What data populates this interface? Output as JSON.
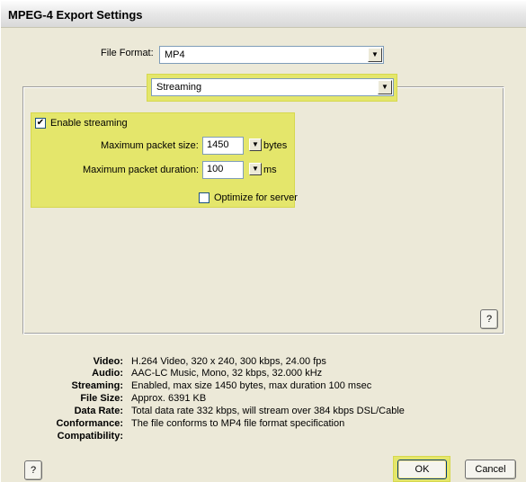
{
  "window": {
    "title": "MPEG-4 Export Settings"
  },
  "file_format": {
    "label": "File Format:",
    "value": "MP4"
  },
  "section_dropdown": {
    "value": "Streaming"
  },
  "streaming": {
    "enable_label": "Enable streaming",
    "enable_checked": true,
    "max_packet_size_label": "Maximum packet size:",
    "max_packet_size_value": "1450",
    "max_packet_size_unit": "bytes",
    "max_packet_duration_label": "Maximum packet duration:",
    "max_packet_duration_value": "100",
    "max_packet_duration_unit": "ms",
    "optimize_label": "Optimize for server",
    "optimize_checked": false
  },
  "help_label": "?",
  "summary": [
    {
      "key": "Video:",
      "value": "H.264 Video, 320 x 240, 300 kbps, 24.00 fps"
    },
    {
      "key": "Audio:",
      "value": "AAC-LC Music, Mono, 32 kbps, 32.000 kHz"
    },
    {
      "key": "Streaming:",
      "value": "Enabled, max size 1450 bytes, max duration 100 msec"
    },
    {
      "key": "File Size:",
      "value": "Approx. 6391 KB"
    },
    {
      "key": "Data Rate:",
      "value": "Total data rate 332 kbps, will stream over 384 kbps DSL/Cable"
    },
    {
      "key": "Conformance:",
      "value": "The file conforms to MP4 file format specification"
    },
    {
      "key": "Compatibility:",
      "value": ""
    }
  ],
  "buttons": {
    "ok": "OK",
    "cancel": "Cancel"
  },
  "colors": {
    "highlight": "#e4e66b",
    "dialog_bg": "#ece9d8"
  },
  "icons": {
    "checkmark": "✔",
    "dropdown_arrow": "▼"
  }
}
